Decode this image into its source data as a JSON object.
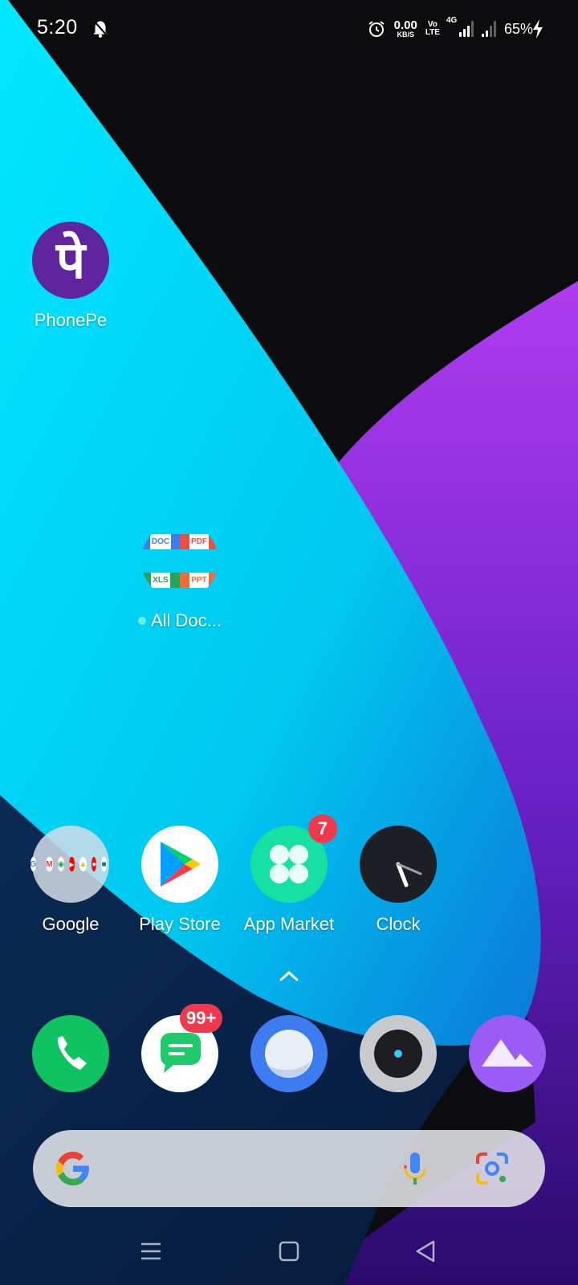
{
  "status_bar": {
    "time": "5:20",
    "net_speed_value": "0.00",
    "net_speed_unit": "KB/S",
    "volte_top": "Vo",
    "volte_bottom": "LTE",
    "network_type": "4G",
    "battery": "65%",
    "icons": [
      "snooze-bell-icon",
      "alarm-icon",
      "signal-icon",
      "charging-icon"
    ]
  },
  "home": {
    "apps": [
      {
        "id": "phonepe",
        "label": "PhonePe",
        "glyph": "पे",
        "color": "#5f259f"
      },
      {
        "id": "all-docs",
        "label": "All Doc...",
        "new_indicator": true,
        "tiles": [
          "DOC",
          "PDF",
          "XLS",
          "PPT"
        ]
      },
      {
        "id": "google-folder",
        "label": "Google"
      },
      {
        "id": "play-store",
        "label": "Play Store"
      },
      {
        "id": "app-market",
        "label": "App Market",
        "badge": "7"
      },
      {
        "id": "clock",
        "label": "Clock"
      }
    ]
  },
  "dock": {
    "messages_badge": "99+",
    "items": [
      "phone-icon",
      "messages-icon",
      "browser-icon",
      "camera-icon",
      "gallery-icon"
    ]
  },
  "search": {
    "icons": [
      "google-g-icon",
      "mic-icon",
      "lens-icon"
    ]
  },
  "nav": {
    "icons": [
      "menu-icon",
      "home-icon",
      "back-icon"
    ]
  },
  "colors": {
    "cyan": "#00e5ff",
    "purple": "#8a2be2",
    "dark": "#0b0b0d",
    "badge": "#f0394d",
    "phonepe": "#5f259f",
    "phone_green": "#0fc460",
    "app_market": "#16e1a2"
  }
}
